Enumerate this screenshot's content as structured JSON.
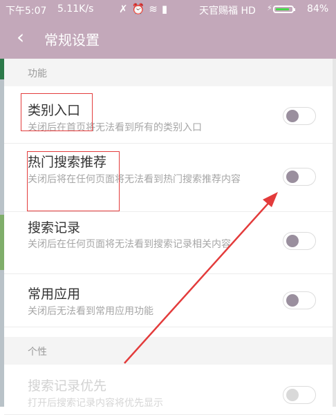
{
  "status_bar": {
    "time": "下午5:07",
    "speed": "5.11K/s",
    "icons": [
      "nfc-icon",
      "alarm-icon",
      "wifi-icon",
      "signal-icon"
    ],
    "carrier": "天官赐福 HD",
    "battery_percent": 84,
    "battery_label": "84%",
    "battery_color": "#46d64a"
  },
  "header": {
    "back_icon": "chevron-left-icon",
    "title": "常规设置",
    "background": "#c3a8ba"
  },
  "sections": [
    {
      "title": "功能",
      "items": [
        {
          "label": "类别入口",
          "desc": "关闭后在首页将无法看到所有的类别入口",
          "enabled": false
        },
        {
          "label": "热门搜索推荐",
          "desc": "关闭后将在任何页面将无法看到热门搜索推荐内容",
          "enabled": false
        },
        {
          "label": "搜索记录",
          "desc": "关闭后在任何页面将无法看到搜索记录相关内容",
          "enabled": false
        },
        {
          "label": "常用应用",
          "desc": "关闭后无法看到常用应用功能",
          "enabled": false
        }
      ]
    },
    {
      "title": "个性",
      "items": [
        {
          "label": "搜索记录优先",
          "desc": "打开后搜索记录内容将优先显示",
          "enabled": false
        }
      ]
    }
  ],
  "annotation": {
    "color": "#e33b3b",
    "arrow": "red-arrow-pointing-to-hot-search-toggle"
  }
}
